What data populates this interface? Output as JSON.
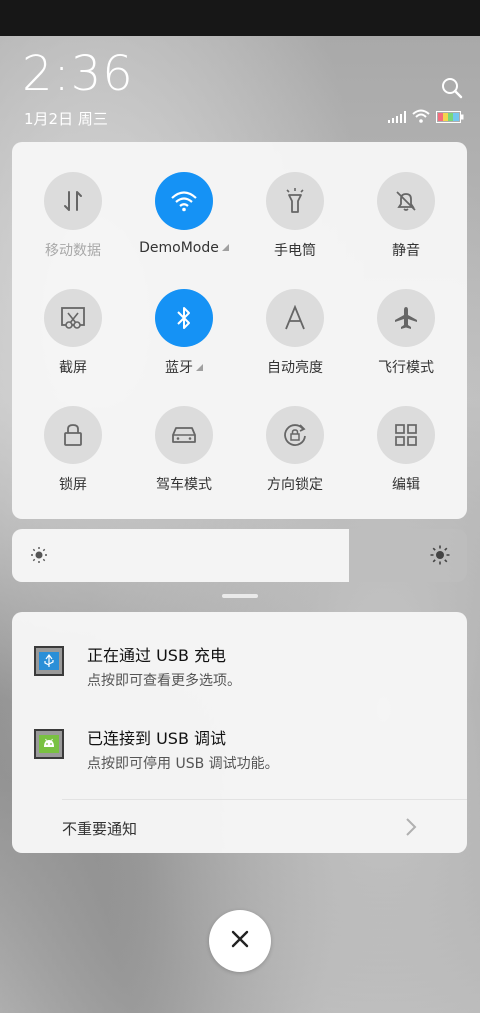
{
  "status_bar": {
    "clock": "2:36",
    "date": "1月2日 周三"
  },
  "quick_settings": {
    "tiles": [
      {
        "id": "mobile-data",
        "label": "移动数据",
        "active": false,
        "dim": true,
        "icon": "mobile-data-icon"
      },
      {
        "id": "wifi",
        "label": "DemoMode",
        "active": true,
        "has_menu": true,
        "icon": "wifi-icon"
      },
      {
        "id": "flashlight",
        "label": "手电筒",
        "active": false,
        "icon": "flashlight-icon"
      },
      {
        "id": "mute",
        "label": "静音",
        "active": false,
        "icon": "bell-off-icon"
      },
      {
        "id": "screenshot",
        "label": "截屏",
        "active": false,
        "icon": "scissors-icon"
      },
      {
        "id": "bluetooth",
        "label": "蓝牙",
        "active": true,
        "has_menu": true,
        "icon": "bluetooth-icon"
      },
      {
        "id": "auto-brightness",
        "label": "自动亮度",
        "active": false,
        "icon": "letter-a-icon"
      },
      {
        "id": "airplane",
        "label": "飞行模式",
        "active": false,
        "icon": "airplane-icon"
      },
      {
        "id": "lock-screen",
        "label": "锁屏",
        "active": false,
        "icon": "lock-icon"
      },
      {
        "id": "driving-mode",
        "label": "驾车模式",
        "active": false,
        "icon": "car-icon"
      },
      {
        "id": "rotation-lock",
        "label": "方向锁定",
        "active": false,
        "icon": "rotation-lock-icon"
      },
      {
        "id": "edit",
        "label": "编辑",
        "active": false,
        "icon": "grid-icon"
      }
    ]
  },
  "brightness": {
    "level": 0.74
  },
  "notifications": [
    {
      "title": "正在通过 USB 充电",
      "subtitle": "点按即可查看更多选项。",
      "icon": "usb-icon"
    },
    {
      "title": "已连接到 USB 调试",
      "subtitle": "点按即可停用 USB 调试功能。",
      "icon": "android-icon"
    }
  ],
  "unimportant_label": "不重要通知",
  "colors": {
    "accent": "#1592f5",
    "tile_off": "#dcdcdc"
  }
}
